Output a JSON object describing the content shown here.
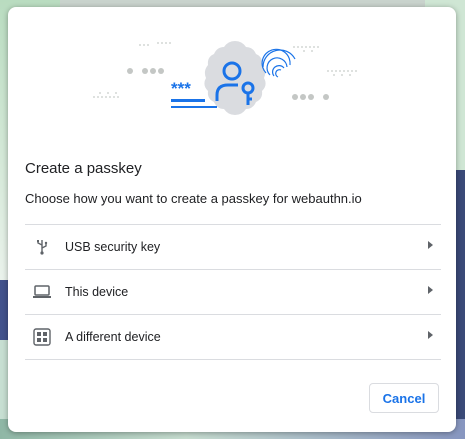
{
  "dialog": {
    "title": "Create a passkey",
    "subtitle": "Choose how you want to create a passkey for webauthn.io",
    "options": [
      {
        "label": "USB security key",
        "icon": "usb-icon"
      },
      {
        "label": "This device",
        "icon": "laptop-icon"
      },
      {
        "label": "A different device",
        "icon": "qr-code-icon"
      }
    ],
    "cancel_label": "Cancel",
    "hero_password_mask": "***"
  },
  "colors": {
    "accent": "#1a73e8",
    "illustration_blob": "#dadce0",
    "text": "#202124",
    "divider": "#dadce0"
  }
}
